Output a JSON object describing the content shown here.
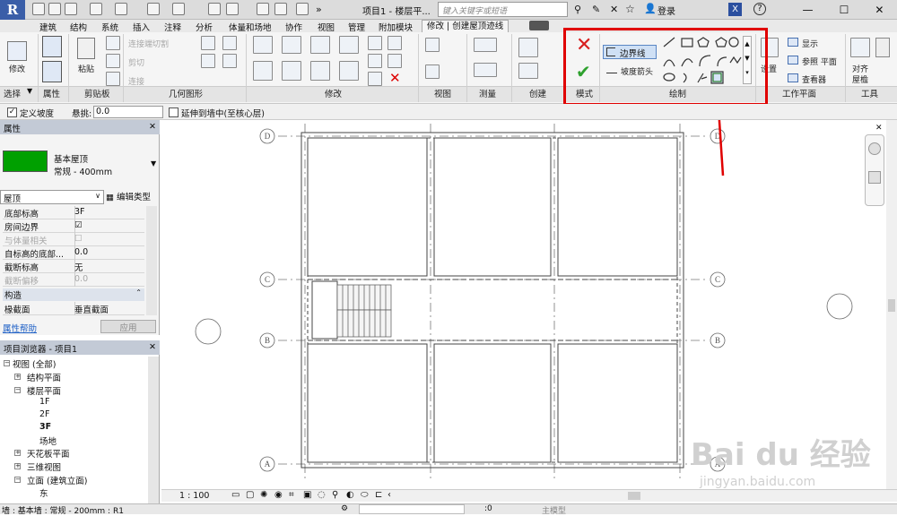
{
  "app": {
    "logo": "R"
  },
  "titlebar": {
    "doc_title": "项目1 - 楼层平...",
    "search_placeholder": "键入关键字或短语",
    "login": "登录"
  },
  "tabs": [
    "建筑",
    "结构",
    "系统",
    "插入",
    "注释",
    "分析",
    "体量和场地",
    "协作",
    "视图",
    "管理",
    "附加模块"
  ],
  "active_tab": "修改 | 创建屋顶迹线",
  "ribbon": {
    "modify_label": "修改",
    "paste_label": "粘贴",
    "clip_join": "连接端切割",
    "clip_cut": "剪切",
    "clip_connect": "连接",
    "boundary_line": "边界线",
    "slope_arrow": "坡度箭头",
    "settings": "设置",
    "show": "显示",
    "ref_plane": "参照 平面",
    "viewer": "查看器",
    "align_label": "对齐",
    "eave": "屋檐"
  },
  "panels": {
    "select": "选择",
    "properties": "属性",
    "clipboard": "剪贴板",
    "geometry": "几何图形",
    "modify": "修改",
    "view": "视图",
    "measure": "测量",
    "create": "创建",
    "mode": "模式",
    "draw": "绘制",
    "work_plane": "工作平面",
    "tools": "工具"
  },
  "options_bar": {
    "define_slope": "定义坡度",
    "overhang_label": "悬挑:",
    "overhang_value": "0.0",
    "extend_wall": "延伸到墙中(至核心层)"
  },
  "properties": {
    "header": "属性",
    "type_name": "基本屋顶",
    "type_sub": "常规 - 400mm",
    "swatch_color": "#00a000",
    "category": "屋顶",
    "edit_type": "编辑类型",
    "rows": [
      {
        "key": "底部标高",
        "value": "3F"
      },
      {
        "key": "房间边界",
        "value": "☑"
      },
      {
        "key": "与体量相关",
        "value": "☐"
      },
      {
        "key": "自标高的底部...",
        "value": "0.0"
      },
      {
        "key": "截断标高",
        "value": "无"
      },
      {
        "key": "截断偏移",
        "value": "0.0"
      }
    ],
    "section_construction": "构造",
    "rafter_key": "椽截面",
    "rafter_value": "垂直截面",
    "help_link": "属性帮助",
    "apply_button": "应用"
  },
  "browser": {
    "header": "项目浏览器 - 项目1",
    "items": [
      "视图 (全部)",
      "结构平面",
      "楼层平面",
      "1F",
      "2F",
      "3F",
      "场地",
      "天花板平面",
      "三维视图",
      "立面 (建筑立面)",
      "东"
    ]
  },
  "canvas": {
    "grid_labels": [
      "D",
      "C",
      "B",
      "A"
    ],
    "accent_color": "#e00000"
  },
  "viewbar": {
    "scale": "1 : 100"
  },
  "statusbar": {
    "text": "墙 : 基本墙 : 常规 - 200mm : R1",
    "count": ":0",
    "model": "主模型"
  },
  "watermark": {
    "brand": "Bai du 经验",
    "url": "jingyan.baidu.com"
  }
}
